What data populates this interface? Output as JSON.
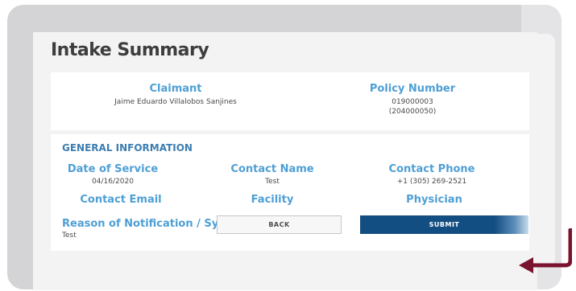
{
  "page": {
    "title": "Intake Summary"
  },
  "claimant": {
    "label": "Claimant",
    "value": "Jaime Eduardo Villalobos Sanjines"
  },
  "policy": {
    "label": "Policy Number",
    "value_line1": "019000003",
    "value_line2": "(204000050)"
  },
  "general": {
    "heading": "GENERAL INFORMATION",
    "date_of_service": {
      "label": "Date of Service",
      "value": "04/16/2020"
    },
    "contact_name": {
      "label": "Contact Name",
      "value": "Test"
    },
    "contact_phone": {
      "label": "Contact Phone",
      "value": "+1 (305) 269-2521"
    },
    "contact_email": {
      "label": "Contact Email",
      "value": ""
    },
    "facility": {
      "label": "Facility",
      "value": ""
    },
    "physician": {
      "label": "Physician",
      "value": ""
    },
    "reason": {
      "label": "Reason of Notification / Symptoms",
      "value": "Test"
    }
  },
  "actions": {
    "back_label": "BACK",
    "submit_label": "SUBMIT"
  },
  "colors": {
    "label_blue": "#4e9fd5",
    "heading_blue": "#3b7db2",
    "submit_blue": "#134e83",
    "arrow_maroon": "#7a1330"
  },
  "icons": {
    "pointer": "arrow-pointer-icon"
  }
}
